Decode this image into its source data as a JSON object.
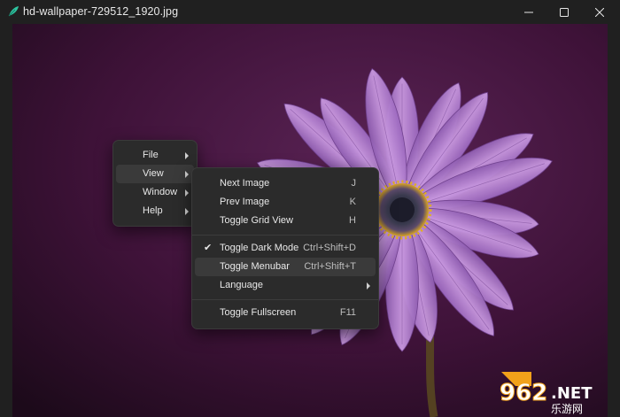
{
  "window": {
    "title": "hd-wallpaper-729512_1920.jpg"
  },
  "colors": {
    "background": "#4a1a45",
    "petal": "#b07ad0",
    "center": "#2a2a3a",
    "pollen": "#e0b020",
    "menu_bg": "#2b2b2b",
    "highlight": "#3a3a3a"
  },
  "main_menu": {
    "items": [
      {
        "label": "File"
      },
      {
        "label": "View"
      },
      {
        "label": "Window"
      },
      {
        "label": "Help"
      }
    ],
    "active": "View"
  },
  "view_menu": {
    "items": [
      {
        "label": "Next Image",
        "shortcut": "J"
      },
      {
        "label": "Prev Image",
        "shortcut": "K"
      },
      {
        "label": "Toggle Grid View",
        "shortcut": "H"
      },
      {
        "label": "Toggle Dark Mode",
        "shortcut": "Ctrl+Shift+D",
        "checked": true
      },
      {
        "label": "Toggle Menubar",
        "shortcut": "Ctrl+Shift+T"
      },
      {
        "label": "Language",
        "shortcut": ""
      },
      {
        "label": "Toggle Fullscreen",
        "shortcut": "F11"
      }
    ],
    "hovered": "Toggle Menubar"
  },
  "watermark": {
    "number": "962",
    "suffix": ".NET",
    "subtitle": "乐游网"
  },
  "icons": {
    "app": "feather-icon",
    "minimize": "minimize-icon",
    "maximize": "maximize-icon",
    "close": "close-icon",
    "check": "checkmark-icon",
    "submenu": "chevron-right-icon"
  }
}
